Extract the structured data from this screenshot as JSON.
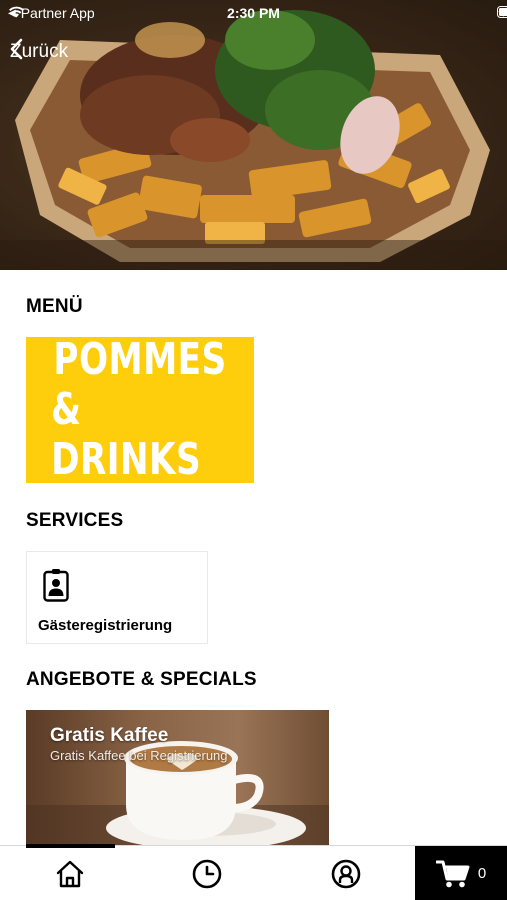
{
  "status_bar": {
    "app_back_label": "Partner App",
    "time": "2:30 PM"
  },
  "nav": {
    "back_label": "Zurück"
  },
  "sections": {
    "menu_title": "MENÜ",
    "services_title": "SERVICES",
    "offers_title": "ANGEBOTE & SPECIALS"
  },
  "menu_tile": {
    "line1": "POMMES",
    "line2": "& DRINKS",
    "color": "#fecd0b"
  },
  "services": [
    {
      "label": "Gästeregistrierung",
      "icon": "id-badge-icon"
    }
  ],
  "offers": [
    {
      "title": "Gratis Kaffee",
      "subtitle": "Gratis Kaffee bei Registrierung"
    }
  ],
  "tabbar": {
    "tabs": [
      {
        "icon": "home-icon"
      },
      {
        "icon": "clock-icon"
      },
      {
        "icon": "user-icon"
      }
    ],
    "cart_count": "0"
  }
}
